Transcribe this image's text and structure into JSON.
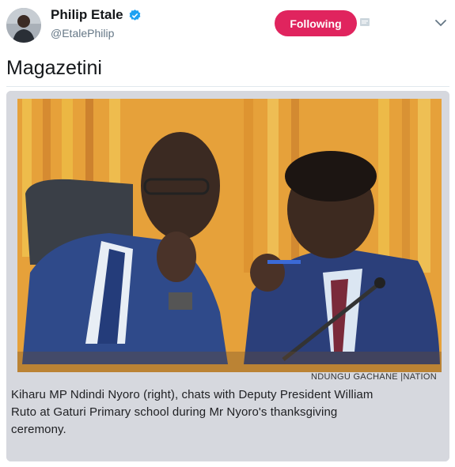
{
  "user": {
    "display_name": "Philip Etale",
    "handle": "@EtalePhilip",
    "verified_icon": "verified-badge-icon",
    "avatar_icon": "avatar"
  },
  "actions": {
    "follow_label": "Following",
    "follow_color": "#e0245e",
    "sms_icon": "sms-icon",
    "menu_icon": "chevron-down-icon"
  },
  "tweet": {
    "text": "Magazetini"
  },
  "media": {
    "photo_credit": "NDUNGU GACHANE |NATION",
    "caption_lines": [
      "Kiharu MP Ndindi Nyoro (right), chats with Deputy President William",
      "Ruto at Gaturi Primary school during Mr Nyoro's thanksgiving",
      "ceremony."
    ]
  }
}
